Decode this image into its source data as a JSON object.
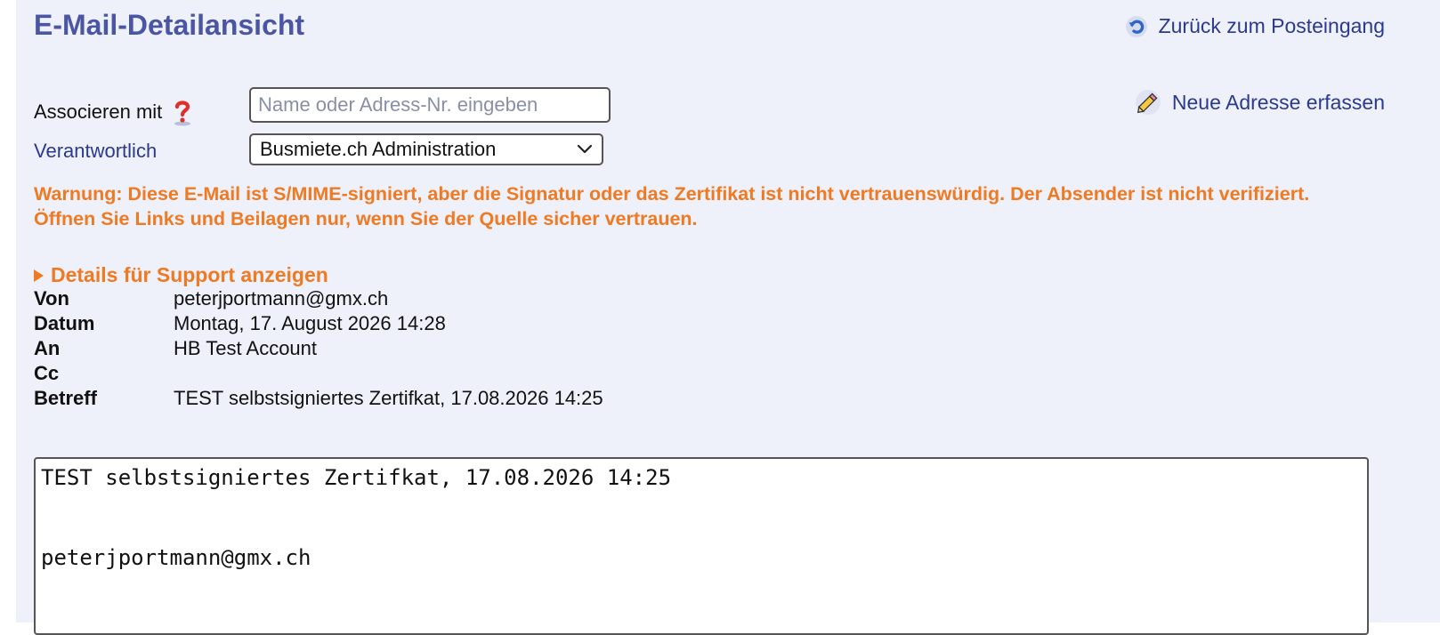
{
  "title": "E-Mail-Detailansicht",
  "back_link": {
    "label": "Zurück zum Posteingang",
    "icon": "undo-icon"
  },
  "new_address": {
    "label": "Neue Adresse erfassen",
    "icon": "pencil-icon"
  },
  "associate": {
    "label": "Associeren mit",
    "help_icon": "question-mark-icon",
    "input_value": "",
    "placeholder": "Name oder Adress-Nr. eingeben"
  },
  "responsible": {
    "label": "Verantwortlich",
    "selected": "Busmiete.ch Administration"
  },
  "warning": "Warnung: Diese E-Mail ist S/MIME-signiert, aber die Signatur oder das Zertifikat ist nicht vertrauenswürdig. Der Absender ist nicht verifiziert. Öffnen Sie Links und Beilagen nur, wenn Sie der Quelle sicher vertrauen.",
  "details_toggle": "Details für Support anzeigen",
  "headers": [
    {
      "key": "Von",
      "value": "peterjportmann@gmx.ch"
    },
    {
      "key": "Datum",
      "value": "Montag, 17. August 2026 14:28"
    },
    {
      "key": "An",
      "value": "HB Test Account"
    },
    {
      "key": "Cc",
      "value": ""
    },
    {
      "key": "Betreff",
      "value": "TEST selbstsigniertes Zertifkat, 17.08.2026 14:25"
    }
  ],
  "body": {
    "line1": "TEST selbstsigniertes Zertifkat, 17.08.2026 14:25",
    "line2": "peterjportmann@gmx.ch"
  },
  "colors": {
    "title": "#4a56a3",
    "link": "#2b3a8f",
    "warning": "#f07a22",
    "panel": "#eef0fa"
  }
}
